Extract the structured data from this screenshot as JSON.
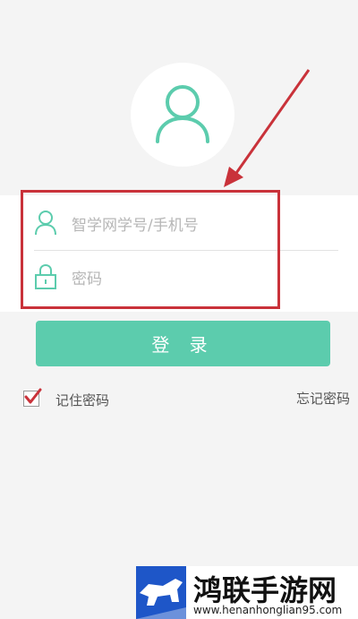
{
  "login_form": {
    "username_placeholder": "智学网学号/手机号",
    "password_placeholder": "密码",
    "login_button_label": "登 录",
    "remember_password_label": "记住密码",
    "remember_password_checked": true,
    "forgot_password_label": "忘记密码"
  },
  "icons": {
    "avatar": "user-avatar-icon",
    "username": "user-icon",
    "password": "lock-icon",
    "checkbox": "checkmark-icon"
  },
  "watermark": {
    "brand": "鸿联手游网",
    "domain": "www.henanhonglian95.com"
  },
  "colors": {
    "accent": "#5cccad",
    "annotation_red": "#c9323a",
    "background": "#f4f4f4",
    "watermark_blue": "#1e56c8"
  }
}
